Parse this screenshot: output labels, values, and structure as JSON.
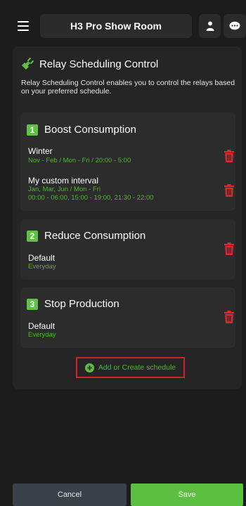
{
  "header": {
    "title": "H3 Pro Show Room",
    "menu_icon": "hamburger-menu-icon",
    "user_icon": "user-icon",
    "chat_icon": "chat-bubble-icon"
  },
  "main": {
    "title": "Relay Scheduling Control",
    "title_icon": "plug-relay-icon",
    "description": "Relay Scheduling Control enables you to control the relays based on your preferred schedule."
  },
  "groups": [
    {
      "number": "1",
      "title": "Boost Consumption",
      "schedules": [
        {
          "title": "Winter",
          "details": [
            "Nov - Feb / Mon - Fri / 20:00 - 5:00"
          ]
        },
        {
          "title": "My custom interval",
          "details": [
            "Jan, Mar, Jun / Mon - Fri",
            "00:00 - 06:00, 15:00 - 19:00, 21:30 - 22:00"
          ]
        }
      ]
    },
    {
      "number": "2",
      "title": "Reduce Consumption",
      "schedules": [
        {
          "title": "Default",
          "details": [
            "Everyday"
          ]
        }
      ]
    },
    {
      "number": "3",
      "title": "Stop Production",
      "schedules": [
        {
          "title": "Default",
          "details": [
            "Everyday"
          ]
        }
      ]
    }
  ],
  "add_schedule": {
    "label": "Add or Create schedule",
    "icon": "plus-circle-icon"
  },
  "footer": {
    "cancel_label": "Cancel",
    "save_label": "Save"
  },
  "colors": {
    "accent_green": "#5dbf41",
    "delete_red": "#d9282f",
    "highlight_red": "#d91f2a",
    "background": "#1c1c1c"
  }
}
